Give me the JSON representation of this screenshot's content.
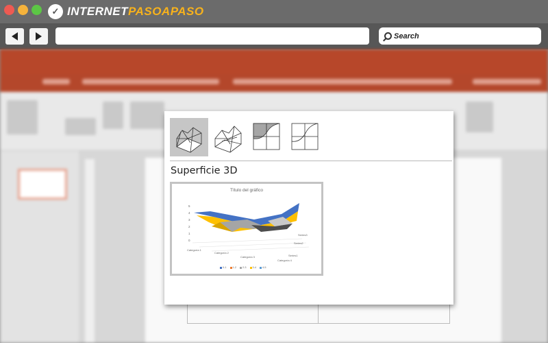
{
  "browser": {
    "logo_text_left": "INTERNET",
    "logo_text_accent": "PASOAPASO",
    "search_placeholder": "Search",
    "traffic_lights": [
      "#ee5a52",
      "#f5b23b",
      "#5cc645"
    ]
  },
  "chart_gallery": {
    "subtypes": [
      {
        "name": "Superficie 3D",
        "icon": "surface-3d-filled-icon",
        "selected": true
      },
      {
        "name": "Trama de superficie 3D",
        "icon": "surface-3d-wireframe-icon",
        "selected": false
      },
      {
        "name": "Contorno",
        "icon": "contour-filled-icon",
        "selected": false
      },
      {
        "name": "Trama de contorno",
        "icon": "contour-wireframe-icon",
        "selected": false
      }
    ],
    "selected_title": "Superficie 3D"
  },
  "chart_data": {
    "type": "surface-3d",
    "title": "Título del gráfico",
    "categories": [
      "Categoría 1",
      "Categoría 2",
      "Categoría 3",
      "Categoría 4"
    ],
    "series": [
      "Series1",
      "Series2",
      "Series3"
    ],
    "yticks": [
      "0",
      "1",
      "2",
      "3",
      "4",
      "5"
    ],
    "legend": [
      "0-1",
      "1-2",
      "2-3",
      "3-4",
      "4-5"
    ],
    "band_colors": [
      "#4472c4",
      "#ed7d31",
      "#a5a5a5",
      "#ffc000",
      "#5b9bd5"
    ],
    "legend_position": "bottom",
    "grid": true
  }
}
